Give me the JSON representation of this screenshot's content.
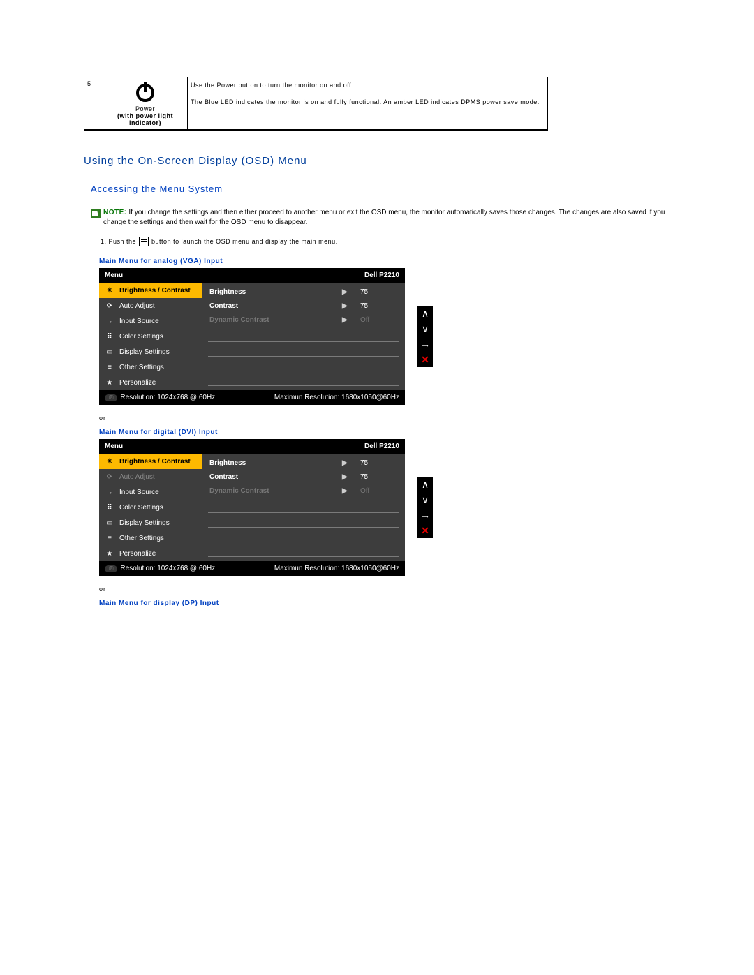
{
  "table": {
    "row_num": "5",
    "icon_caption_1": "Power",
    "icon_caption_2": "(with power light indicator)",
    "desc_line1": "Use the Power button to turn the monitor on and off.",
    "desc_line2": "The Blue LED indicates the monitor is on and fully functional. An amber LED indicates DPMS power save mode."
  },
  "section_heading": "Using the On-Screen Display (OSD) Menu",
  "subsection_heading": "Accessing the Menu System",
  "note": {
    "label": "NOTE:",
    "text": "If you change the settings and then either proceed to another menu or exit the OSD menu, the monitor automatically saves those changes. The changes are also saved if you change the settings and then wait for the OSD menu to disappear."
  },
  "step1_pre": "1. Push the",
  "step1_post": "button to launch the OSD menu and display the main menu.",
  "labels": {
    "vga": "Main Menu for analog (VGA) Input",
    "dvi": "Main Menu for digital (DVI) Input",
    "dp": "Main Menu for display (DP) Input",
    "or": "or"
  },
  "osd_common": {
    "menu_label": "Menu",
    "model": "Dell P2210",
    "resolution": "Resolution: 1024x768 @ 60Hz",
    "max_resolution": "Maximun Resolution: 1680x1050@60Hz",
    "left_items": [
      "Brightness / Contrast",
      "Auto Adjust",
      "Input Source",
      "Color Settings",
      "Display Settings",
      "Other Settings",
      "Personalize"
    ],
    "right_items": {
      "brightness": {
        "label": "Brightness",
        "value": "75"
      },
      "contrast": {
        "label": "Contrast",
        "value": "75"
      },
      "dynamic": {
        "label": "Dynamic Contrast",
        "value": "Off"
      }
    }
  }
}
